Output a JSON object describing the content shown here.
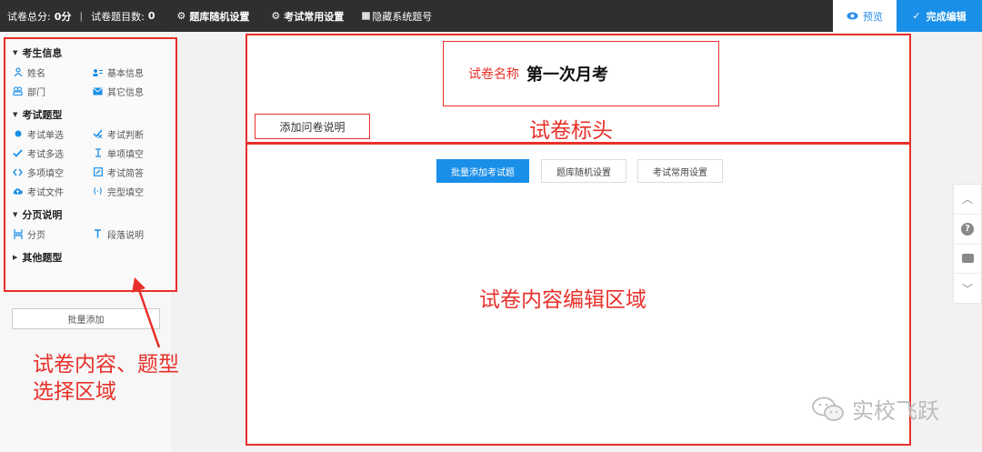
{
  "topbar": {
    "score_label": "试卷总分:",
    "score_value": "0分",
    "count_label": "试卷题目数:",
    "count_value": "0",
    "random_setting": "题库随机设置",
    "common_setting": "考试常用设置",
    "hide_number": "隐藏系统题号",
    "preview": "预览",
    "done": "完成编辑"
  },
  "sidebar": {
    "sections": [
      {
        "title": "考生信息",
        "items": [
          {
            "label": "姓名",
            "icon": "person-icon"
          },
          {
            "label": "基本信息",
            "icon": "id-card-icon"
          },
          {
            "label": "部门",
            "icon": "group-icon"
          },
          {
            "label": "其它信息",
            "icon": "mail-icon"
          }
        ]
      },
      {
        "title": "考试题型",
        "items": [
          {
            "label": "考试单选",
            "icon": "radio-dot-icon"
          },
          {
            "label": "考试判断",
            "icon": "judge-icon"
          },
          {
            "label": "考试多选",
            "icon": "check-icon"
          },
          {
            "label": "单项填空",
            "icon": "text-cursor-icon"
          },
          {
            "label": "多项填空",
            "icon": "code-icon"
          },
          {
            "label": "考试简答",
            "icon": "edit-doc-icon"
          },
          {
            "label": "考试文件",
            "icon": "cloud-upload-icon"
          },
          {
            "label": "完型填空",
            "icon": "bracket-dots-icon"
          }
        ]
      },
      {
        "title": "分页说明",
        "items": [
          {
            "label": "分页",
            "icon": "page-break-icon"
          },
          {
            "label": "段落说明",
            "icon": "text-t-icon"
          }
        ]
      },
      {
        "title": "其他题型",
        "items": []
      }
    ],
    "batch_add": "批量添加"
  },
  "header": {
    "title_label": "试卷名称",
    "title_value": "第一次月考",
    "add_note": "添加问卷说明"
  },
  "content": {
    "batch_add_questions": "批量添加考试题",
    "random_setting": "题库随机设置",
    "common_setting": "考试常用设置"
  },
  "annotations": {
    "left_line1": "试卷内容、题型",
    "left_line2": "选择区域",
    "header": "试卷标头",
    "content": "试卷内容编辑区域"
  },
  "watermark": "实校飞跃",
  "colors": {
    "accent": "#1a8fe8",
    "annotation": "#e8302a",
    "topbar": "#2f2f2f"
  }
}
